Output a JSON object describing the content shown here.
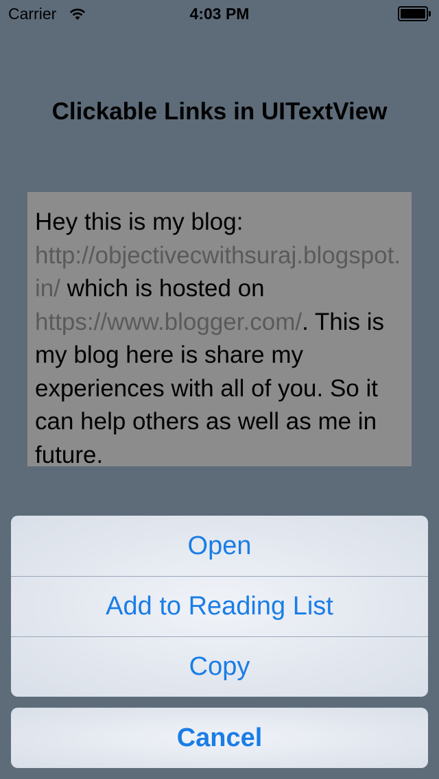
{
  "status_bar": {
    "carrier": "Carrier",
    "time": "4:03 PM",
    "wifi_icon": "wifi-icon",
    "battery_icon": "battery-icon"
  },
  "title": "Clickable Links in UITextView",
  "text_view": {
    "intro": "Hey this is my blog: ",
    "link1": "http://objectivecwithsuraj.blogspot.in/",
    "middle": " which is hosted on ",
    "link2": "https://www.blogger.com/",
    "outro": ". This is my blog here is share my experiences with all of you. So it can help others as well as me in future."
  },
  "action_sheet": {
    "open": "Open",
    "add_to_reading_list": "Add to Reading List",
    "copy": "Copy",
    "cancel": "Cancel"
  },
  "colors": {
    "background": "#5e6c7a",
    "text_view_background": "#8c8c8c",
    "link": "#5a5a5a",
    "action_tint": "#1a7de6"
  }
}
